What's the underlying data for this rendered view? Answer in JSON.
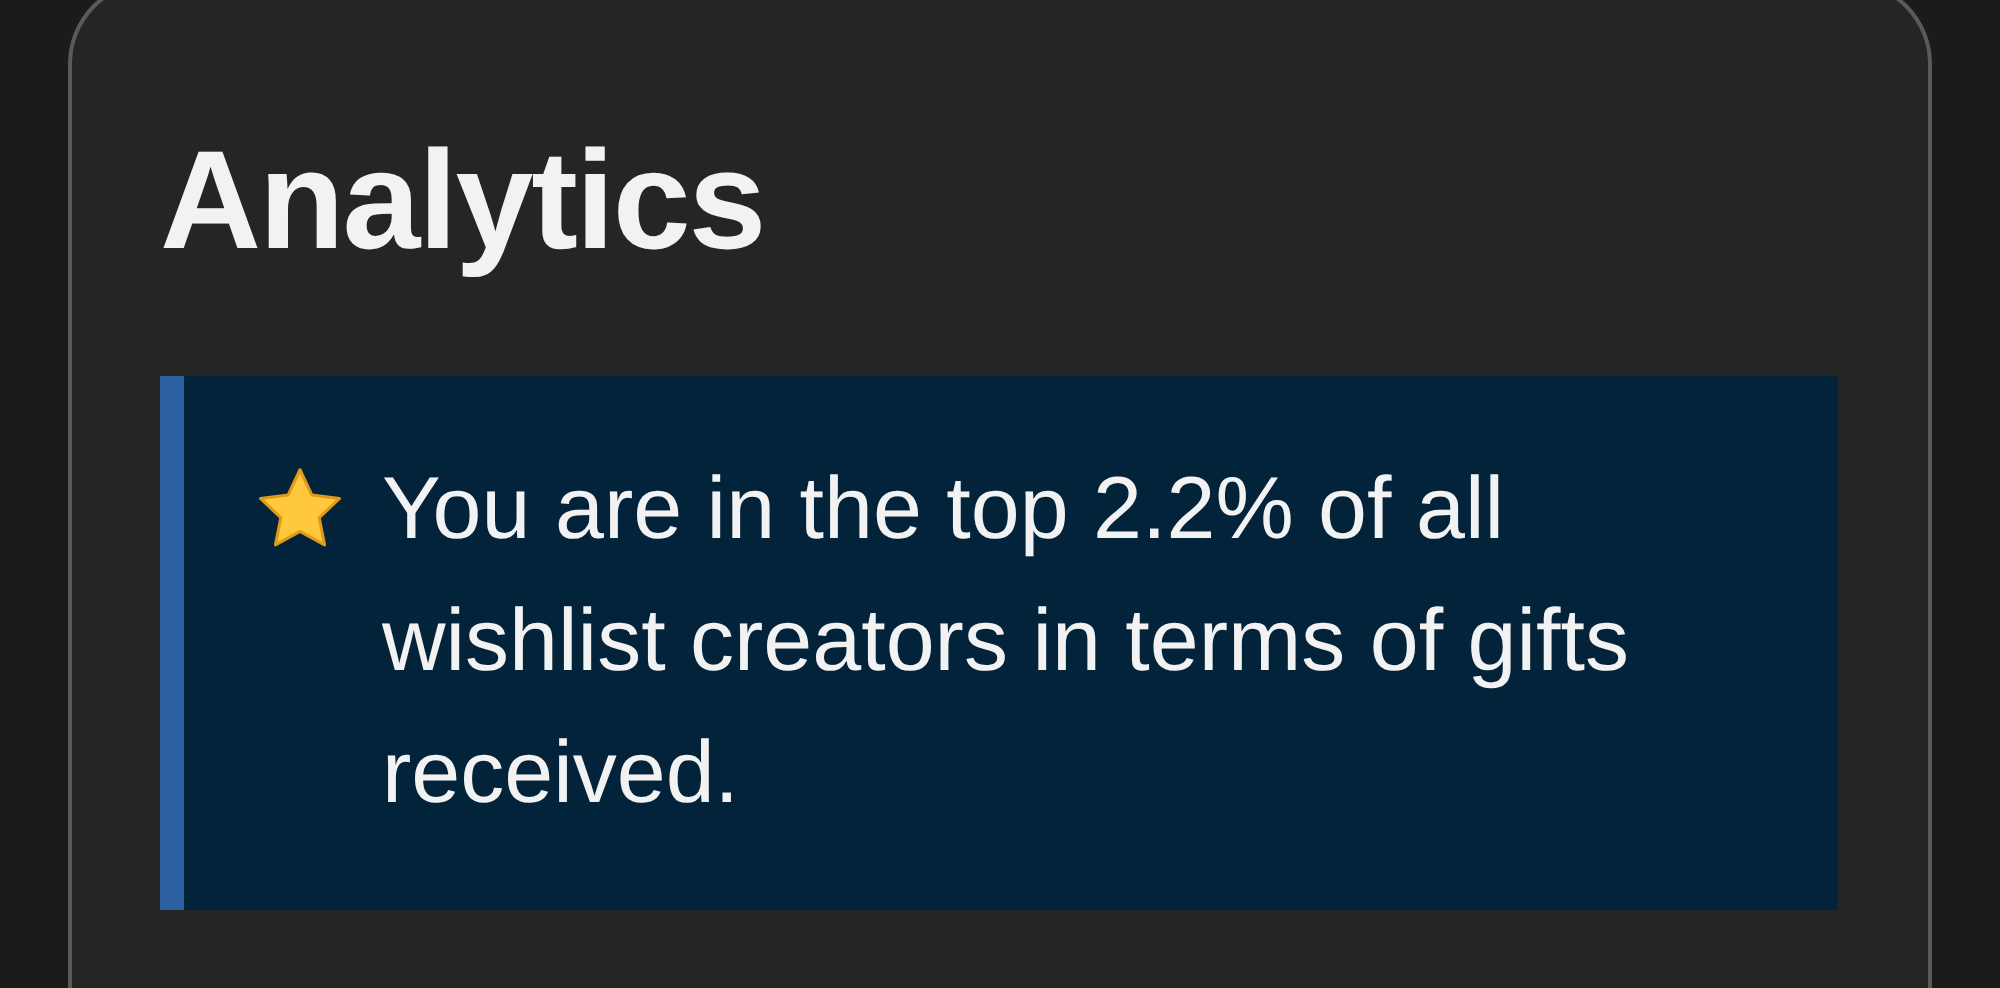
{
  "card": {
    "title": "Analytics",
    "callout": {
      "text": "You are in the top 2.2% of all wishlist creators in terms of gifts received."
    }
  }
}
